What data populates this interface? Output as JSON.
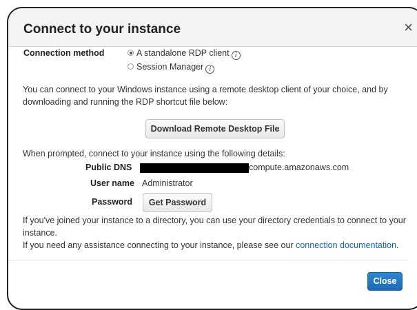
{
  "dialog": {
    "title": "Connect to your instance",
    "close_symbol": "×"
  },
  "connection_method": {
    "label": "Connection method",
    "options": [
      {
        "label": "A standalone RDP client",
        "selected": true
      },
      {
        "label": "Session Manager",
        "selected": false
      }
    ],
    "info_symbol": "i"
  },
  "intro": {
    "line1": "You can connect to your Windows instance using a remote desktop client of your choice, and by",
    "line2": "downloading and running the RDP shortcut file below:"
  },
  "download_button_label": "Download Remote Desktop File",
  "details": {
    "prompt": "When prompted, connect to your instance using the following details:",
    "public_dns_label": "Public DNS",
    "public_dns_suffix": "compute.amazonaws.com",
    "user_name_label": "User name",
    "user_name_value": "Administrator",
    "password_label": "Password",
    "get_password_label": "Get Password"
  },
  "footer_text": {
    "directory_line1": "If you've joined your instance to a directory, you can use your directory credentials to connect to your",
    "directory_line2": "instance.",
    "assist_prefix": "If you need any assistance connecting to your instance, please see our",
    "assist_link": "connection documentation",
    "assist_suffix": "."
  },
  "close_button_label": "Close",
  "colors": {
    "link": "#1166bb",
    "primary_button": "#2074c1",
    "header_background": "#f3f3f3"
  },
  "icons": [
    "close-icon",
    "info-icon",
    "radio-icon"
  ]
}
